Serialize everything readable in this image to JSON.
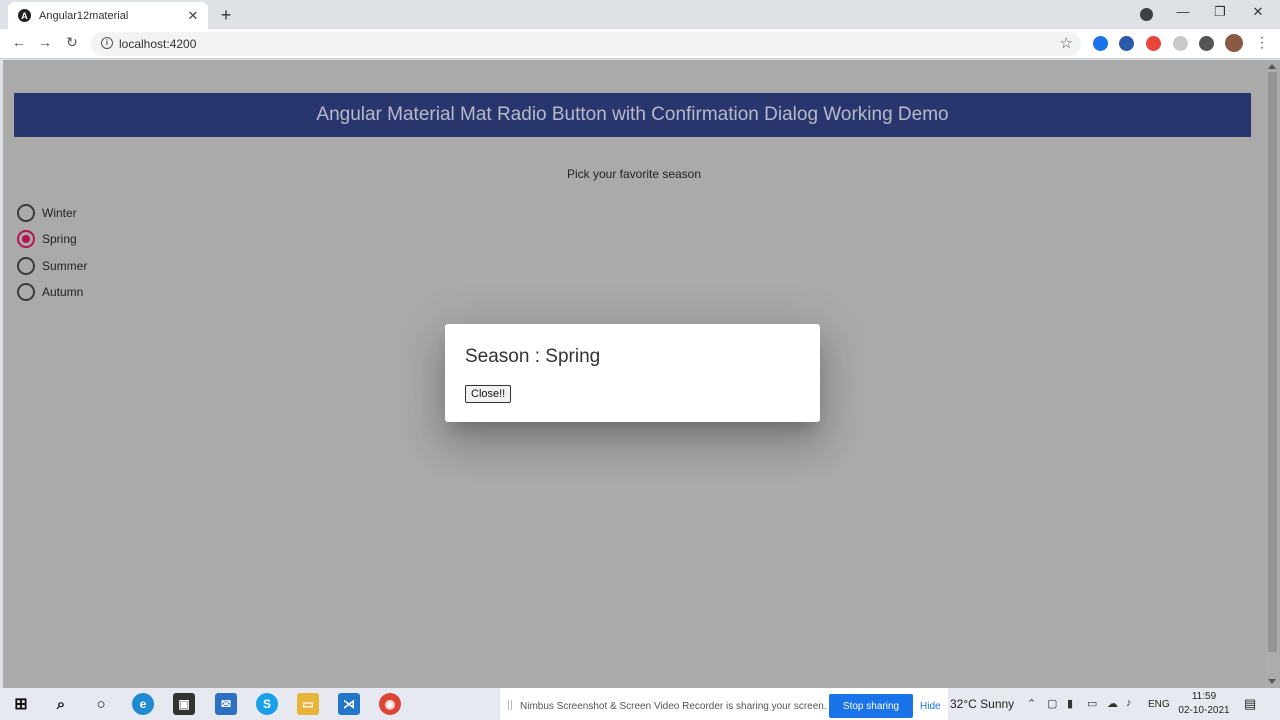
{
  "browser": {
    "tab_title": "Angular12material",
    "tab_favicon_letter": "A",
    "url": "localhost:4200"
  },
  "page": {
    "banner_title": "Angular Material Mat Radio Button with Confirmation Dialog Working Demo",
    "prompt": "Pick your favorite season",
    "options": [
      {
        "label": "Winter",
        "checked": false
      },
      {
        "label": "Spring",
        "checked": true
      },
      {
        "label": "Summer",
        "checked": false
      },
      {
        "label": "Autumn",
        "checked": false
      }
    ],
    "accent_color": "#b2154f",
    "banner_color": "#29366e"
  },
  "dialog": {
    "title": "Season : Spring",
    "close_label": "Close!!"
  },
  "taskbar": {
    "share_text": "Nimbus Screenshot & Screen Video Recorder is sharing your screen.",
    "stop_sharing_label": "Stop sharing",
    "hide_label": "Hide",
    "weather": "32°C  Sunny",
    "language": "ENG",
    "time": "11:59",
    "date": "02-10-2021"
  }
}
